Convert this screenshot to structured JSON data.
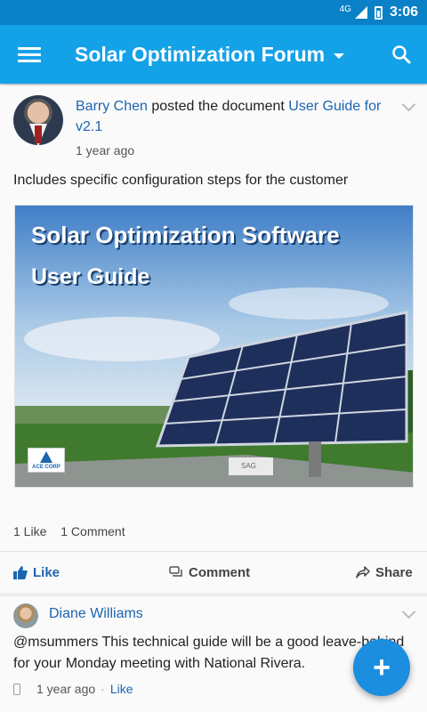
{
  "status": {
    "network": "4G",
    "time": "3:06"
  },
  "appbar": {
    "title": "Solar Optimization Forum"
  },
  "post": {
    "author": "Barry Chen",
    "action": "posted the document",
    "document": "User Guide for v2.1",
    "time": "1 year ago",
    "description": "Includes specific configuration steps for the customer",
    "image_title_line1": "Solar Optimization Software",
    "image_title_line2": "User Guide",
    "image_logo": "ACE CORP",
    "image_sign": "SAG",
    "likes": "1 Like",
    "comments": "1 Comment",
    "actions": {
      "like": "Like",
      "comment": "Comment",
      "share": "Share"
    }
  },
  "comment": {
    "author": "Diane Williams",
    "text": "@msummers This technical guide will be a good leave-behind for your Monday meeting with National Rivera.",
    "time": "1 year ago",
    "like": "Like"
  },
  "colors": {
    "statusbar": "#0a81c6",
    "appbar": "#13a2e8",
    "link": "#1c65b0",
    "fab": "#1b8ee0"
  }
}
